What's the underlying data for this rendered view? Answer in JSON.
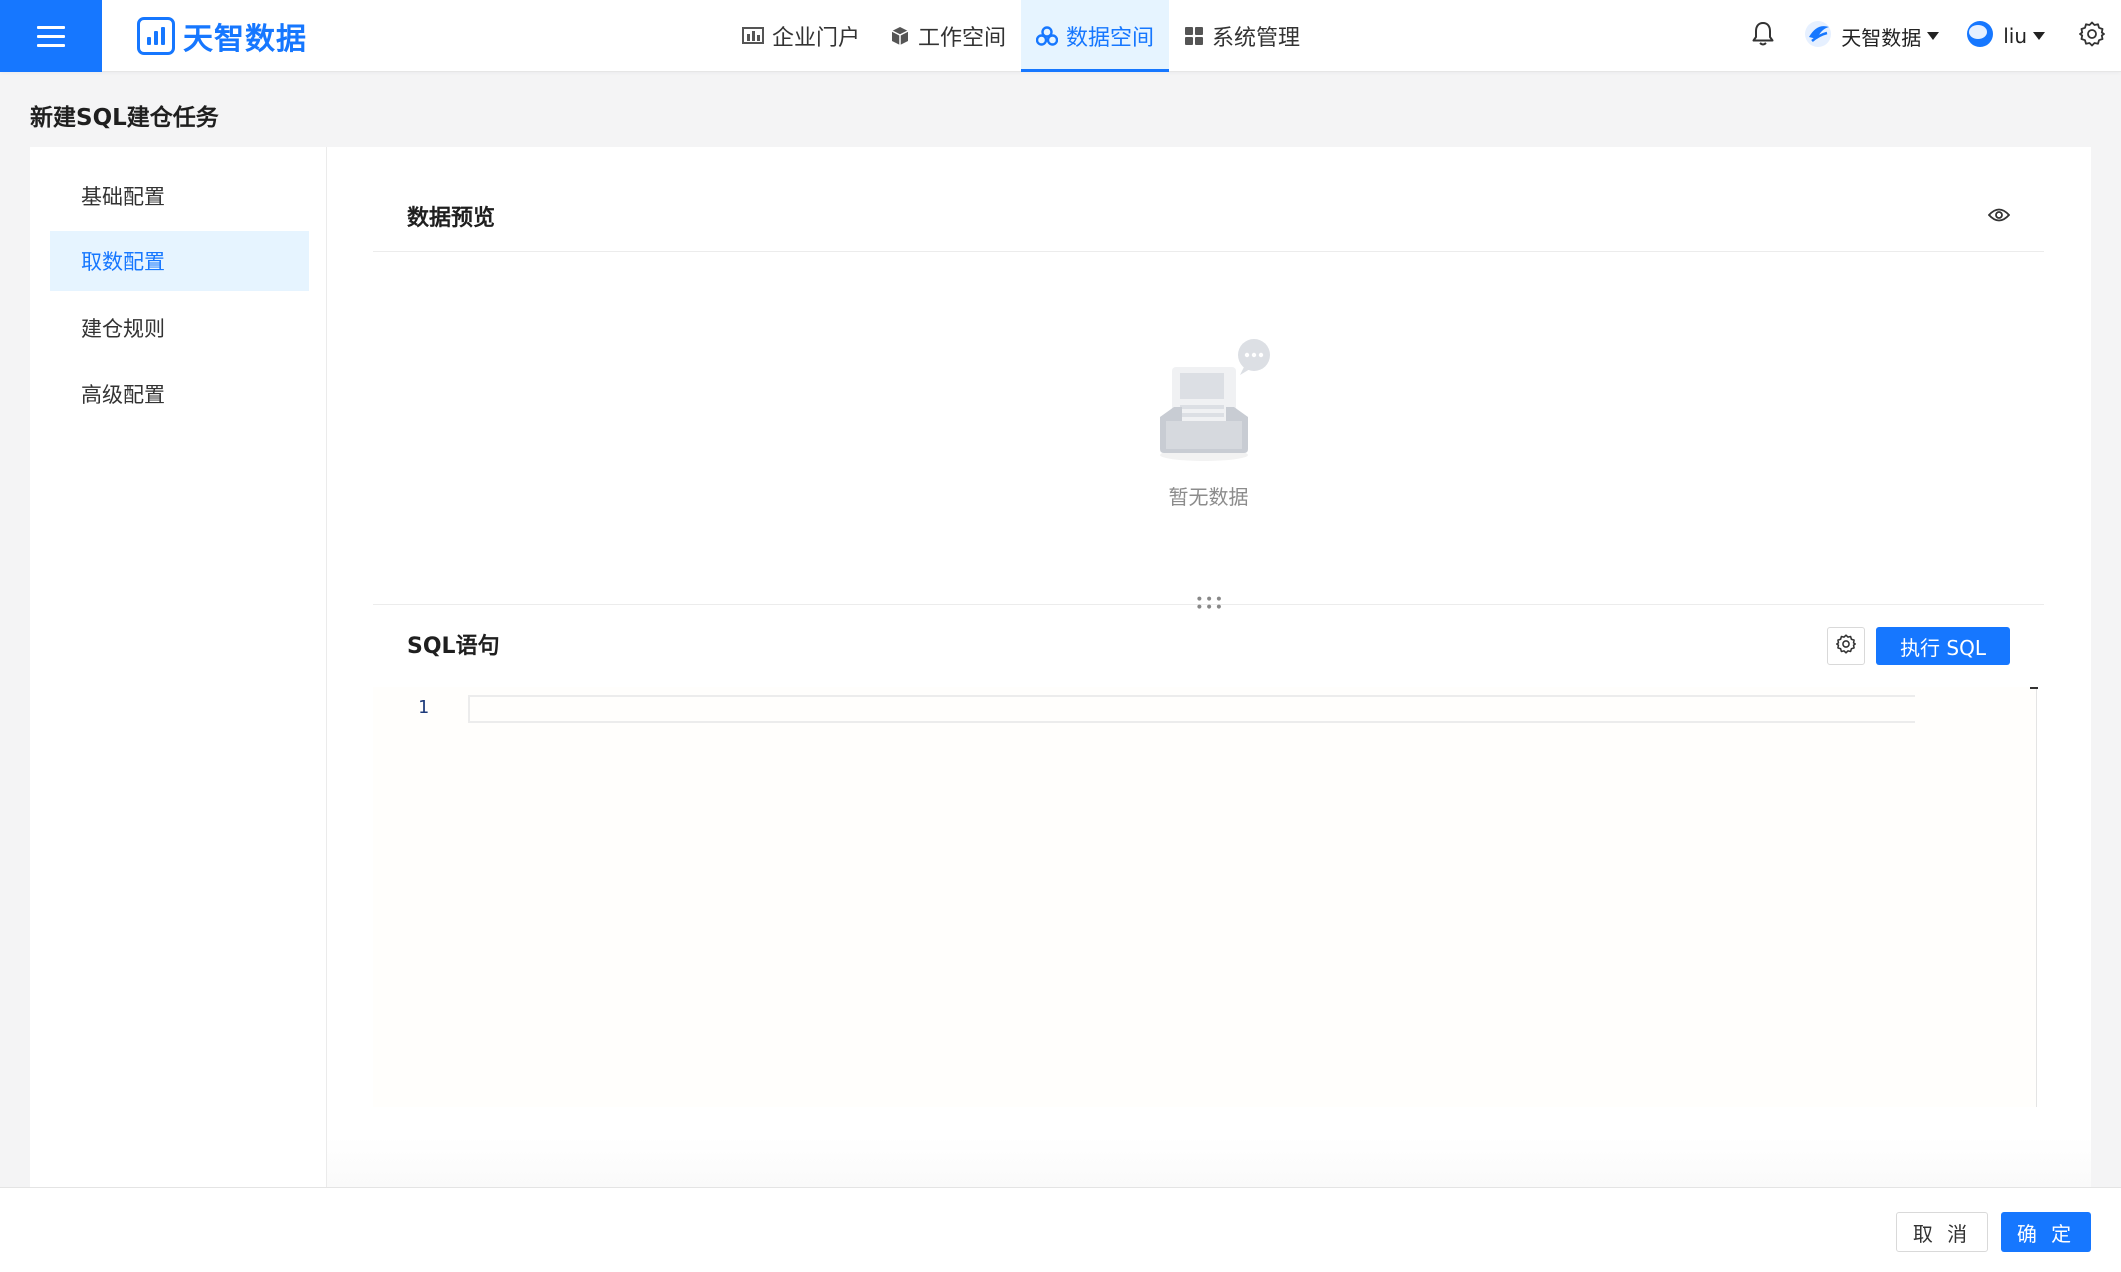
{
  "app": {
    "brand_name": "天智数据"
  },
  "nav": {
    "items": [
      {
        "label": "企业门户",
        "icon": "chart-bars-icon"
      },
      {
        "label": "工作空间",
        "icon": "cube-icon"
      },
      {
        "label": "数据空间",
        "icon": "cluster-icon",
        "active": true
      },
      {
        "label": "系统管理",
        "icon": "grid-icon"
      }
    ]
  },
  "header_right": {
    "tenant": "天智数据",
    "user": "liu"
  },
  "page": {
    "title": "新建SQL建仓任务"
  },
  "sidebar": {
    "items": [
      {
        "label": "基础配置"
      },
      {
        "label": "取数配置",
        "active": true
      },
      {
        "label": "建仓规则"
      },
      {
        "label": "高级配置"
      }
    ]
  },
  "preview": {
    "title": "数据预览",
    "empty_text": "暂无数据"
  },
  "sql": {
    "title": "SQL语句",
    "run_label": "执行 SQL",
    "line_number": "1"
  },
  "footer": {
    "cancel_label": "取 消",
    "ok_label": "确 定"
  },
  "colors": {
    "primary": "#1677ff",
    "active_bg": "#e6f4ff",
    "page_bg": "#f4f4f5"
  }
}
